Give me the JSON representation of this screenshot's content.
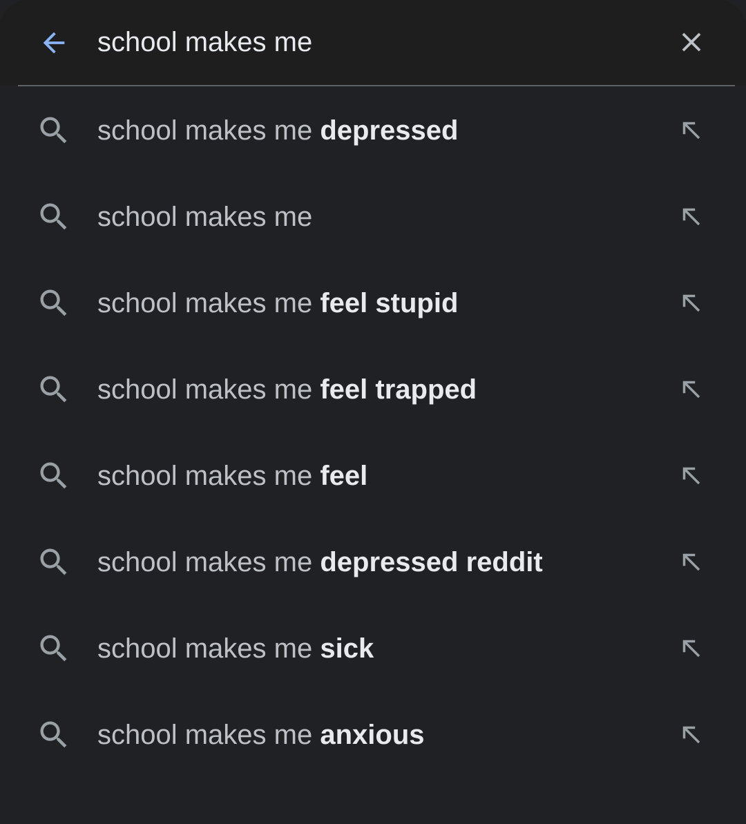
{
  "search": {
    "value": "school makes me",
    "accent_color": "#8ab4f8"
  },
  "icons": {
    "back": "arrow-back-icon",
    "clear": "close-icon",
    "suggestion": "search-icon",
    "fill": "arrow-up-left-icon"
  },
  "suggestions": [
    {
      "prefix": "school makes me",
      "completion": "depressed"
    },
    {
      "prefix": "school makes me",
      "completion": ""
    },
    {
      "prefix": "school makes me",
      "completion": "feel stupid"
    },
    {
      "prefix": "school makes me",
      "completion": "feel trapped"
    },
    {
      "prefix": "school makes me",
      "completion": "feel"
    },
    {
      "prefix": "school makes me",
      "completion": "depressed reddit"
    },
    {
      "prefix": "school makes me",
      "completion": "sick"
    },
    {
      "prefix": "school makes me",
      "completion": "anxious"
    }
  ]
}
